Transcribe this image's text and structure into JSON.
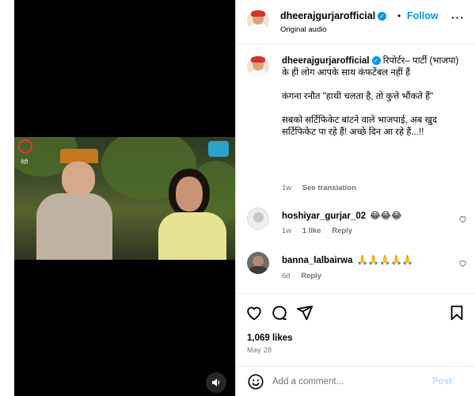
{
  "post": {
    "author": "dheerajgurjarofficial",
    "separator": "•",
    "follow_label": "Follow",
    "audio_label": "Original audio",
    "more_label": "···"
  },
  "media": {
    "logo_text": "नेटी",
    "audio_icon": "speaker-icon"
  },
  "caption": {
    "username": "dheerajgurjarofficial",
    "paragraphs": [
      "रिपोर्टर– पार्टी (भाजपा) के ही लोग आपके साथ कंफर्टेबल नहीं हैं",
      "कंगना रनौत       \"हाथी चलता है, तो कुत्ते भौंकते हैं\"",
      "सबको सर्टिफिकेट बांटने वाले भाजपाई, अब खुद सर्टिफिकेट पा रहे हैं! अच्छे दिन आ रहे हैं...!!"
    ],
    "time": "1w",
    "see_translation": "See translation"
  },
  "comments": [
    {
      "username": "hoshiyar_gurjar_02",
      "text": "😂😂😂",
      "time": "1w",
      "likes": "1 like",
      "reply": "Reply"
    },
    {
      "username": "banna_lalbairwa",
      "text": "🙏🙏🙏🙏🙏",
      "time": "6d",
      "reply": "Reply"
    }
  ],
  "actions": {
    "likes": "1,069 likes",
    "date": "May 28"
  },
  "add_comment": {
    "placeholder": "Add a comment...",
    "post_label": "Post"
  },
  "colors": {
    "accent": "#0095f6",
    "muted": "#737373",
    "post_disabled": "#b3dbff"
  }
}
